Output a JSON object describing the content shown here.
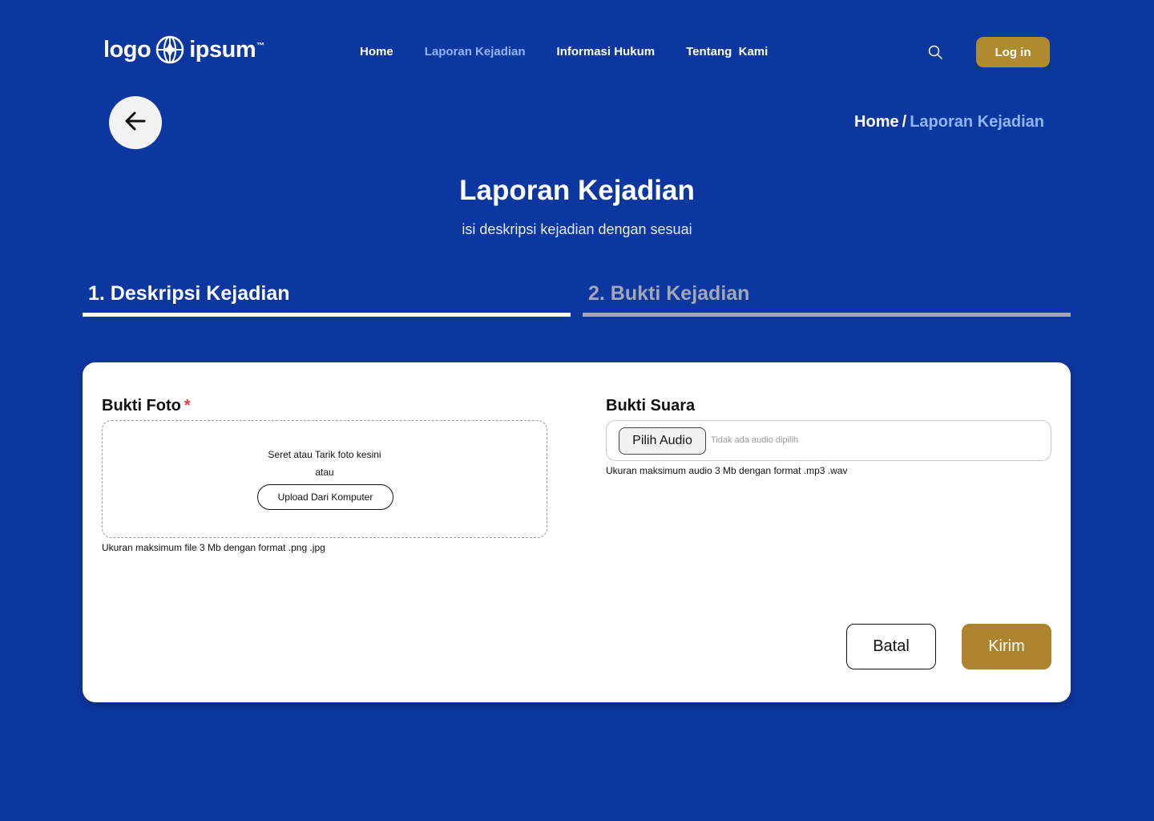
{
  "header": {
    "logo_left": "logo",
    "logo_right": "ipsum",
    "logo_tm": "™",
    "nav": [
      {
        "label": "Home"
      },
      {
        "label": "Laporan Kejadian"
      },
      {
        "label": "Informasi Hukum"
      },
      {
        "label": "Tentang  Kami"
      }
    ],
    "active_nav": "Laporan Kejadian",
    "search_icon": "search-icon",
    "login_label": "Log in"
  },
  "breadcrumb": {
    "home": "Home",
    "separator": "/",
    "current": "Laporan Kejadian"
  },
  "back_icon": "arrow-left-icon",
  "page": {
    "title": "Laporan Kejadian",
    "subtitle": "isi deskripsi kejadian dengan sesuai"
  },
  "steps": [
    {
      "label": "1. Deskripsi Kejadian",
      "state": "active"
    },
    {
      "label": "2. Bukti Kejadian",
      "state": "inactive"
    }
  ],
  "form": {
    "photo": {
      "title": "Bukti Foto",
      "required_mark": "*",
      "drop_text": "Seret atau Tarik foto kesini",
      "or_text": "atau",
      "upload_label": "Upload Dari Komputer",
      "hint": "Ukuran maksimum file 3 Mb dengan format .png .jpg"
    },
    "audio": {
      "title": "Bukti Suara",
      "pick_label": "Pilih Audio",
      "status": "Tidak ada audio dipilih",
      "hint": "Ukuran maksimum audio 3 Mb dengan format .mp3 .wav"
    },
    "cancel_label": "Batal",
    "submit_label": "Kirim"
  },
  "colors": {
    "background": "#0d37a0",
    "accent_gold": "#b08a2e",
    "active_link": "#8fb6ff",
    "inactive_step": "#a3a6b4",
    "required": "#e53935"
  }
}
